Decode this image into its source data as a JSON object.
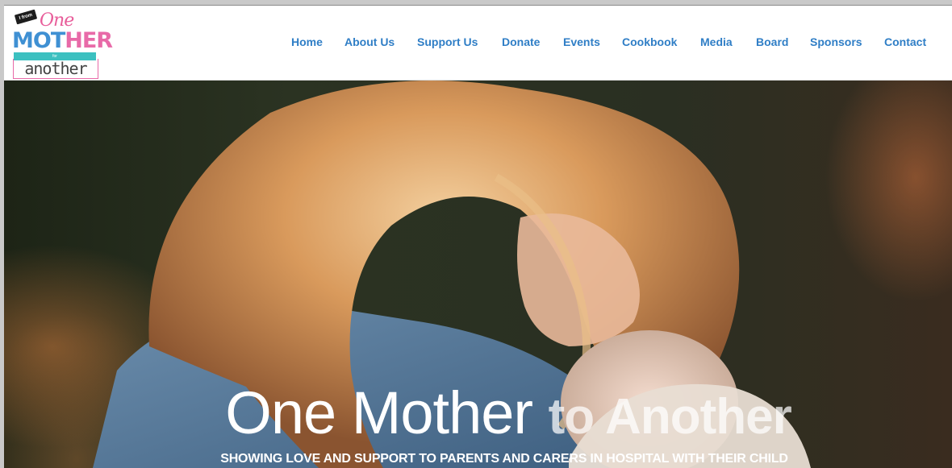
{
  "logo": {
    "tag": "I from",
    "one": "One",
    "mother_a": "MOT",
    "mother_b": "HER",
    "for": "for",
    "another": "another"
  },
  "nav": {
    "items": [
      {
        "label": "Home"
      },
      {
        "label": "About Us"
      },
      {
        "label": "Support Us"
      },
      {
        "label": "Donate"
      },
      {
        "label": "Events"
      },
      {
        "label": "Cookbook"
      },
      {
        "label": "Media"
      },
      {
        "label": "Board"
      },
      {
        "label": "Sponsors"
      },
      {
        "label": "Contact"
      }
    ]
  },
  "hero": {
    "title_part1": "One Mother ",
    "title_part2": "to Another",
    "subtitle": "SHOWING LOVE AND SUPPORT TO PARENTS AND CARERS IN HOSPITAL WITH THEIR CHILD"
  },
  "colors": {
    "nav_link": "#2f7ec6",
    "logo_blue": "#3f90d3",
    "logo_pink": "#e86aa8",
    "logo_teal": "#3cc0c0"
  }
}
